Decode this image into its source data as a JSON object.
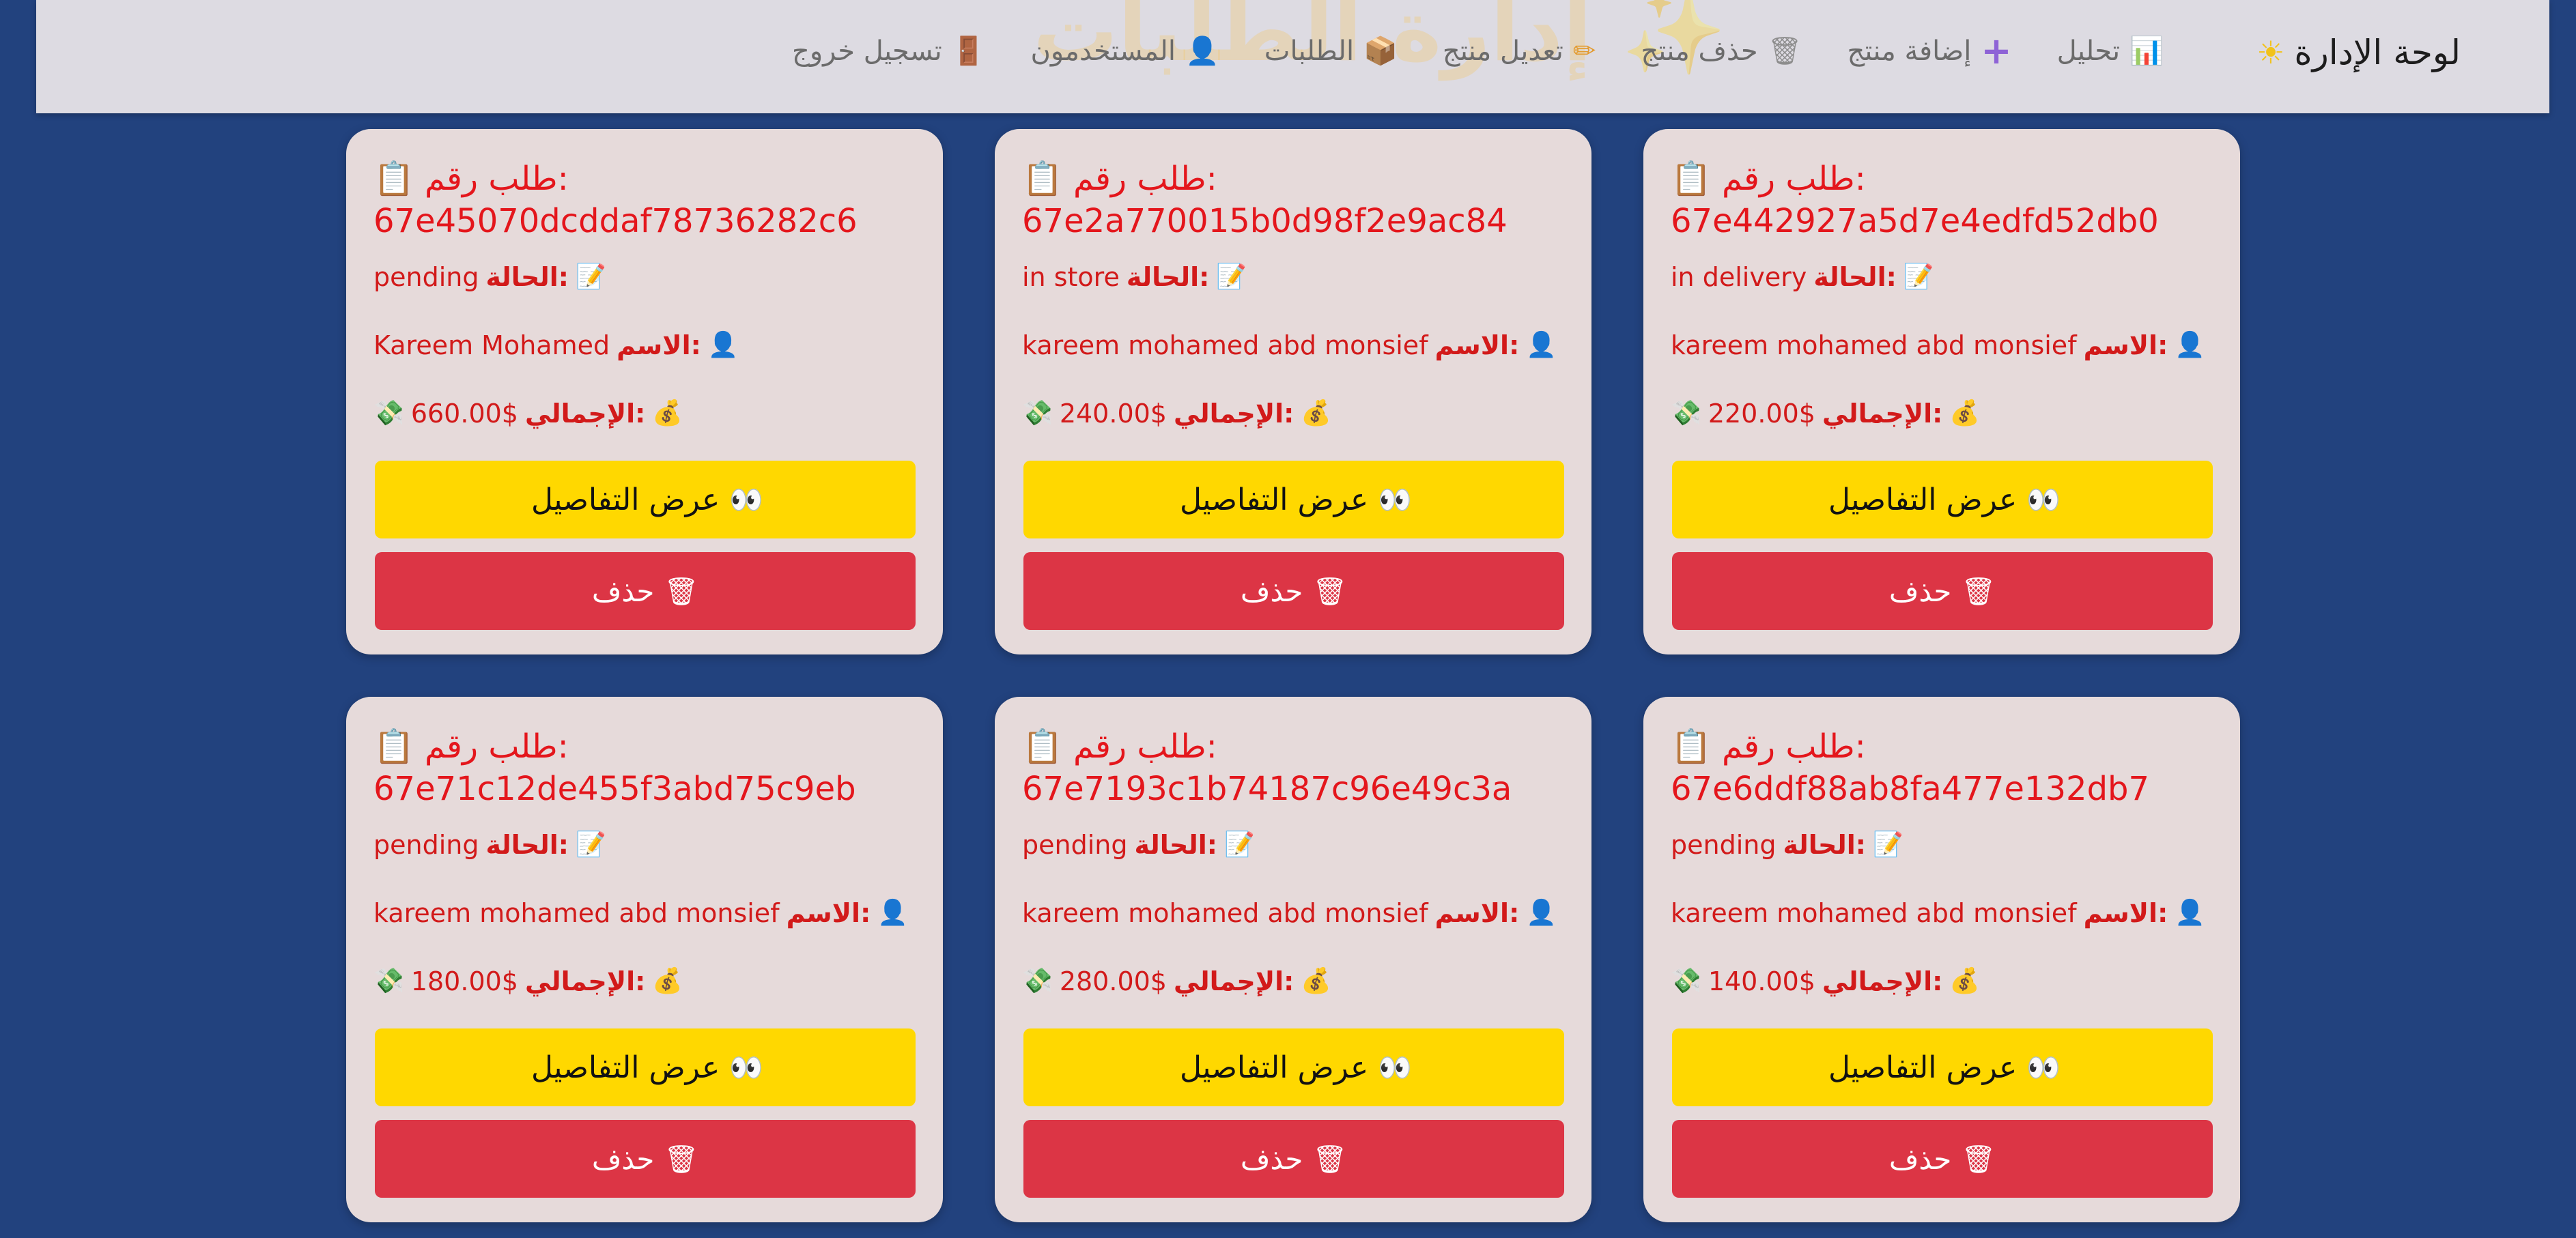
{
  "header": {
    "watermark": "✨ إدارة الطلبات",
    "brand_icon": "☀",
    "brand_label": "لوحة الإدارة"
  },
  "nav": [
    {
      "label": "تحليل",
      "icon": "📊",
      "icon_name": "bar-chart-icon"
    },
    {
      "label": "إضافة منتج",
      "icon": "+",
      "icon_name": "plus-icon"
    },
    {
      "label": "حذف منتج",
      "icon": "🗑",
      "icon_name": "trash-icon"
    },
    {
      "label": "تعديل منتج",
      "icon": "✏",
      "icon_name": "pencil-icon"
    },
    {
      "label": "الطلبات",
      "icon": "📦",
      "icon_name": "package-icon"
    },
    {
      "label": "المستخدمون",
      "icon": "👤",
      "icon_name": "user-icon"
    },
    {
      "label": "تسجيل خروج",
      "icon": "🚪",
      "icon_name": "logout-icon"
    }
  ],
  "labels": {
    "order_prefix": "طلب رقم:",
    "status": "الحالة:",
    "name": "الاسم:",
    "total": "الإجمالي:",
    "details_button": "عرض التفاصيل",
    "delete_button": "حذف"
  },
  "orders": [
    {
      "id": "67e442927a5d7e4edfd52db0",
      "status": "in delivery",
      "name": "kareem mohamed abd monsief",
      "total": "220.00$"
    },
    {
      "id": "67e2a770015b0d98f2e9ac84",
      "status": "in store",
      "name": "kareem mohamed abd monsief",
      "total": "240.00$"
    },
    {
      "id": "67e45070dcddaf78736282c6",
      "status": "pending",
      "name": "Kareem Mohamed",
      "total": "660.00$"
    },
    {
      "id": "67e6ddf88ab8fa477e132db7",
      "status": "pending",
      "name": "kareem mohamed abd monsief",
      "total": "140.00$"
    },
    {
      "id": "67e7193c1b74187c96e49c3a",
      "status": "pending",
      "name": "kareem mohamed abd monsief",
      "total": "280.00$"
    },
    {
      "id": "67e71c12de455f3abd75c9eb",
      "status": "pending",
      "name": "kareem mohamed abd monsief",
      "total": "180.00$"
    }
  ],
  "colors": {
    "page_background": "#22427e",
    "navbar_background": "#dddbe2",
    "card_background": "#e6dada",
    "card_text": "#e4161c",
    "details_button": "#ffd800",
    "delete_button": "#dc3545"
  }
}
